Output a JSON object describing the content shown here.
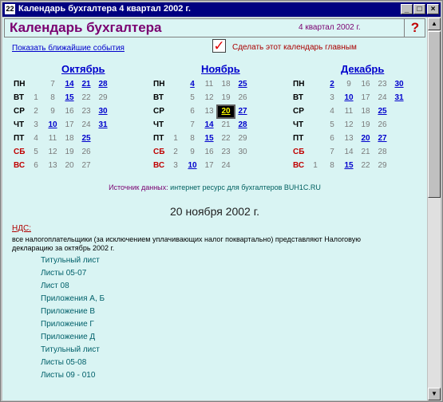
{
  "window": {
    "title": "Календарь бухгалтера 4 квартал 2002 г.",
    "app_icon": "calendar-icon"
  },
  "header": {
    "title": "Календарь бухгалтера",
    "quarter": "4 квартал 2002 г.",
    "help": "?"
  },
  "show_events_link": "Показать ближайшие события",
  "main_checkbox": {
    "label": "Сделать этот календарь главным",
    "checked": true,
    "mark": "✓"
  },
  "day_labels": [
    "ПН",
    "ВТ",
    "СР",
    "ЧТ",
    "ПТ",
    "СБ",
    "ВС"
  ],
  "months": [
    {
      "name": "Октябрь",
      "weeks": [
        [
          null,
          1,
          2,
          3,
          4,
          5,
          6
        ],
        [
          7,
          8,
          9,
          10,
          11,
          12,
          13
        ],
        [
          14,
          15,
          16,
          17,
          18,
          19,
          20
        ],
        [
          21,
          22,
          23,
          24,
          25,
          26,
          27
        ],
        [
          28,
          29,
          30,
          31,
          null,
          null,
          null
        ]
      ],
      "highlight": [
        14,
        15,
        21,
        25,
        28,
        30,
        31,
        10
      ],
      "selected": null
    },
    {
      "name": "Ноябрь",
      "weeks": [
        [
          null,
          null,
          null,
          null,
          1,
          2,
          3
        ],
        [
          4,
          5,
          6,
          7,
          8,
          9,
          10
        ],
        [
          11,
          12,
          13,
          14,
          15,
          16,
          17
        ],
        [
          18,
          19,
          20,
          21,
          22,
          23,
          24
        ],
        [
          25,
          26,
          27,
          28,
          29,
          30,
          null
        ]
      ],
      "highlight": [
        4,
        10,
        14,
        15,
        20,
        25,
        27,
        28
      ],
      "selected": 20
    },
    {
      "name": "Декабрь",
      "weeks": [
        [
          null,
          null,
          null,
          null,
          null,
          null,
          1
        ],
        [
          2,
          3,
          4,
          5,
          6,
          7,
          8
        ],
        [
          9,
          10,
          11,
          12,
          13,
          14,
          15
        ],
        [
          16,
          17,
          18,
          19,
          20,
          21,
          22
        ],
        [
          23,
          24,
          25,
          26,
          27,
          28,
          29
        ],
        [
          30,
          31,
          null,
          null,
          null,
          null,
          null
        ]
      ],
      "highlight": [
        2,
        10,
        15,
        20,
        25,
        27,
        30,
        31
      ],
      "selected": null
    }
  ],
  "source": {
    "label": "Источник данных:",
    "text": "интернет ресурс для бухгалтеров BUH1C.RU"
  },
  "selected_date": "20 ноября 2002 г.",
  "event": {
    "tax": "НДС:",
    "description": "все налогоплательщики (за исключением уплачивающих налог поквартально) представляют Налоговую декларацию за октябрь 2002 г.",
    "documents": [
      "Титульный лист",
      "Листы 05-07",
      "Лист 08",
      "Приложения А, Б",
      "Приложение В",
      "Приложение Г",
      "Приложение Д",
      "Титульный лист",
      "Листы 05-08",
      "Листы 09 - 010"
    ]
  },
  "colors": {
    "link": "#0000cc",
    "title": "#7a0070",
    "weekend": "#c00000",
    "background": "#d9f4f3"
  }
}
